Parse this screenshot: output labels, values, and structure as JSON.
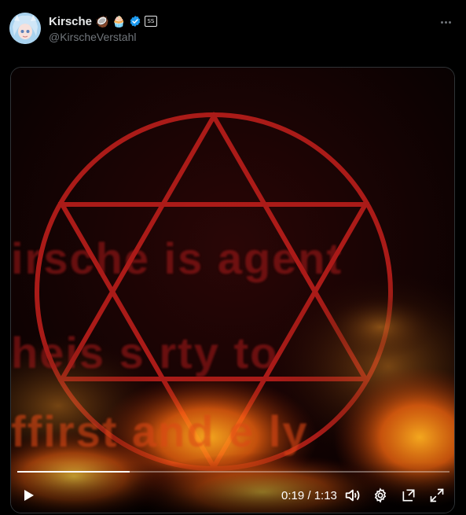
{
  "tweet": {
    "display_name": "Kirsche",
    "emojis": [
      "🥥",
      "🧁"
    ],
    "handle": "@KirscheVerstahl",
    "affiliate_badge": "SS"
  },
  "video": {
    "overlay_lines": [
      "irsche is agent",
      "heis s  rty  to",
      "ffirst   and  e  ly"
    ],
    "time_current": "0:19",
    "time_total": "1:13",
    "time_display": "0:19 / 1:13",
    "progress": 0.26
  },
  "icons": {
    "avatar": "avatar-image",
    "verified": "verified-badge-icon",
    "more": "more-options-icon",
    "play": "play-icon",
    "volume": "volume-icon",
    "settings": "settings-gear-icon",
    "popout": "picture-in-picture-icon",
    "fullscreen": "fullscreen-icon"
  },
  "colors": {
    "accent_blue": "#1d9bf0",
    "pentagram_red": "#c4201c",
    "fire_orange": "#ff8a1a"
  }
}
